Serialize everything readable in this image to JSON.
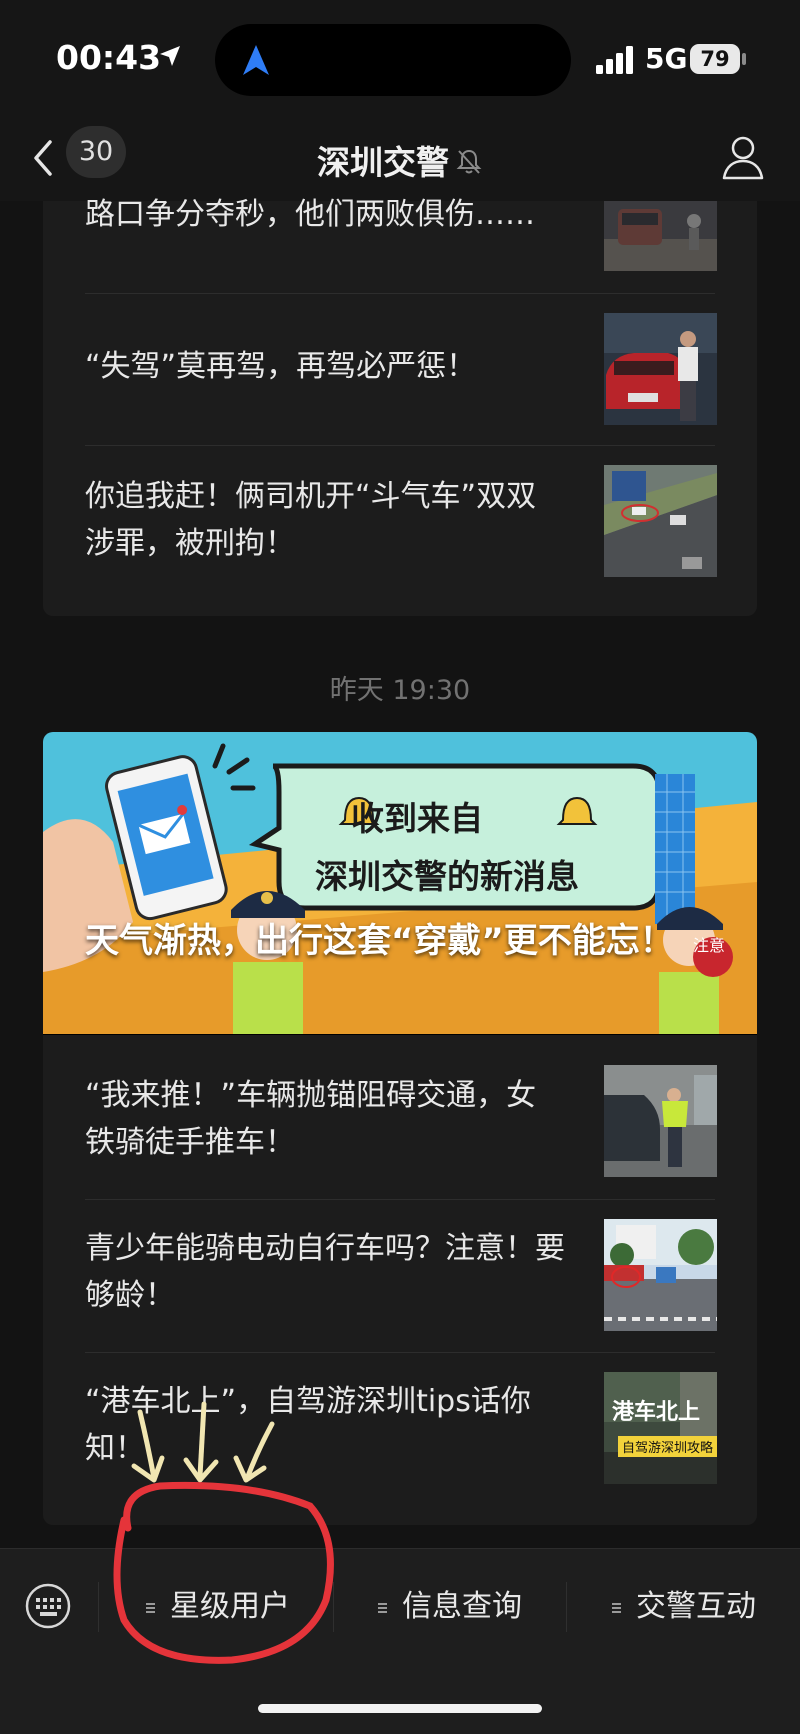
{
  "status_bar": {
    "time": "00:43",
    "network": "5G",
    "battery": "79"
  },
  "nav": {
    "unread_count": "30",
    "title": "深圳交警"
  },
  "group1": {
    "articles": [
      {
        "title": "路口争分夺秒，他们两败俱伤……"
      },
      {
        "title": "“失驾”莫再驾，再驾必严惩！"
      },
      {
        "title": "你追我赶！俩司机开“斗气车”双双涉罪，被刑拘！"
      }
    ]
  },
  "timestamp": "昨天 19:30",
  "group2": {
    "banner": {
      "title": "天气渐热，出行这套“穿戴”更不能忘！",
      "speech_line1": "收到来自",
      "speech_line2": "深圳交警的新消息",
      "tag": "注意"
    },
    "articles": [
      {
        "title": "“我来推！”车辆抛锚阻碍交通，女铁骑徒手推车！"
      },
      {
        "title": "青少年能骑电动自行车吗？注意！要够龄！"
      },
      {
        "title": "“港车北上”，自驾游深圳tips话你知！",
        "thumb_tag1": "港车北上",
        "thumb_tag2": "自驾游深圳攻略"
      }
    ]
  },
  "menu": {
    "items": [
      {
        "label": "星级用户"
      },
      {
        "label": "信息查询"
      },
      {
        "label": "交警互动"
      }
    ]
  },
  "colors": {
    "background": "#131313",
    "card": "#1c1c1c",
    "annotation": "#e5343a",
    "arrows": "#f0e6b4"
  }
}
